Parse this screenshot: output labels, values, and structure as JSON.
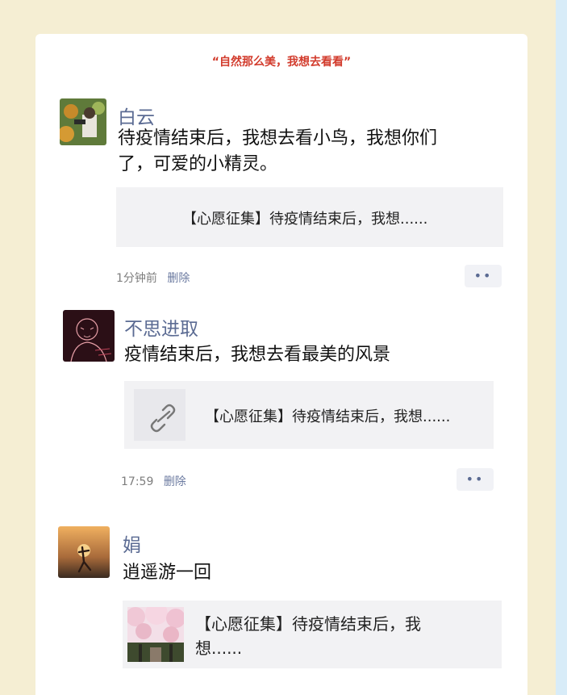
{
  "caption": "“自然那么美，我想去看看”",
  "comments": [
    {
      "name": "白云",
      "text_line1": "待疫情结束后，我想去看小鸟，我想你们",
      "text_line2": "了，可爱的小精灵。",
      "link_title": "【心愿征集】待疫情结束后，我想......",
      "time": "1分钟前",
      "delete": "删除",
      "more": "••"
    },
    {
      "name": "不思进取",
      "text_line1": "疫情结束后，我想去看最美的风景",
      "link_title": "【心愿征集】待疫情结束后，我想......",
      "time": "17:59",
      "delete": "删除",
      "more": "••"
    },
    {
      "name": "娟",
      "text_line1": "逍遥游一回",
      "link_title_line1": "【心愿征集】待疫情结束后，我",
      "link_title_line2": "想......"
    }
  ],
  "icons": {
    "link": "link-icon",
    "more": "more-dots-icon"
  }
}
